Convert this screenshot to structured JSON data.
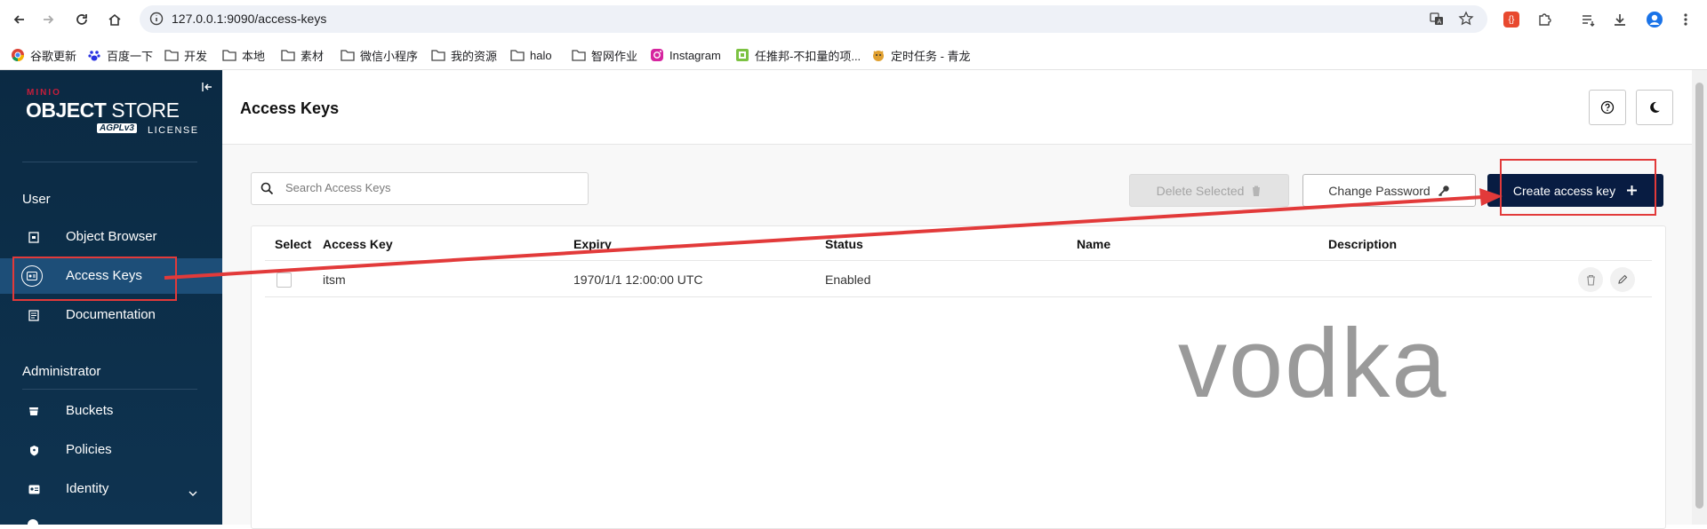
{
  "browser": {
    "url": "127.0.0.1:9090/access-keys",
    "bookmarks": [
      "谷歌更新",
      "百度一下",
      "开发",
      "本地",
      "素材",
      "微信小程序",
      "我的资源",
      "halo",
      "智网作业",
      "Instagram",
      "任推邦-不扣量的项...",
      "定时任务 - 青龙"
    ]
  },
  "sidebar": {
    "brand_top": "MINIO",
    "brand_main_bold": "OBJECT",
    "brand_main_thin": "STORE",
    "brand_agpl": "AGPLv3",
    "brand_license": "LICENSE",
    "section_user": "User",
    "section_admin": "Administrator",
    "items": {
      "object_browser": "Object Browser",
      "access_keys": "Access Keys",
      "documentation": "Documentation",
      "buckets": "Buckets",
      "policies": "Policies",
      "identity": "Identity"
    }
  },
  "header": {
    "title": "Access Keys"
  },
  "toolbar": {
    "search_placeholder": "Search Access Keys",
    "delete_label": "Delete Selected",
    "change_password_label": "Change Password",
    "create_label": "Create access key"
  },
  "table": {
    "columns": [
      "Select",
      "Access Key",
      "Expiry",
      "Status",
      "Name",
      "Description"
    ],
    "rows": [
      {
        "access_key": "itsm",
        "expiry": "1970/1/1 12:00:00 UTC",
        "status": "Enabled",
        "name": "",
        "description": ""
      }
    ]
  },
  "watermark": "vodka",
  "colors": {
    "sidebar": "#0b2a43",
    "primary_button": "#081c42",
    "annotation": "#e23a3a"
  }
}
